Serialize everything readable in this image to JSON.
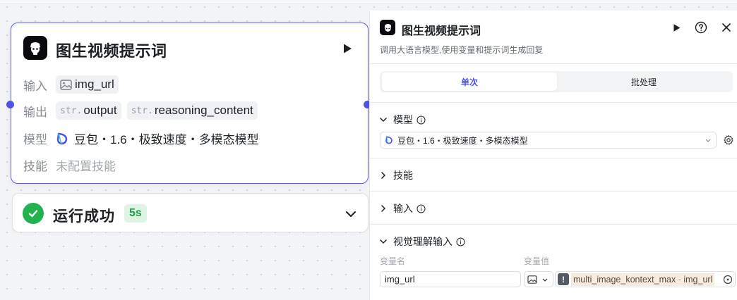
{
  "node": {
    "title": "图生视频提示词",
    "input_label": "输入",
    "input_tags": [
      {
        "text": "img_url"
      }
    ],
    "output_label": "输出",
    "output_tags": [
      {
        "prefix": "str.",
        "text": "output"
      },
      {
        "prefix": "str.",
        "text": "reasoning_content"
      }
    ],
    "model_label": "模型",
    "model_value": "豆包・1.6・极致速度・多模态模型",
    "skill_label": "技能",
    "skill_value": "未配置技能"
  },
  "status": {
    "text": "运行成功",
    "duration": "5s"
  },
  "panel": {
    "title": "图生视频提示词",
    "description": "调用大语言模型,使用变量和提示词生成回复",
    "tabs": [
      {
        "label": "单次",
        "active": true
      },
      {
        "label": "批处理",
        "active": false
      }
    ],
    "model_section": "模型",
    "model_select": "豆包・1.6・极致速度・多模态模型",
    "skills_section": "技能",
    "input_section": "输入",
    "vision_section": "视觉理解输入",
    "var_name_label": "变量名",
    "var_value_label": "变量值",
    "var_name_value": "img_url",
    "ref_node": "multi_image_kontext_max",
    "ref_separator": "-",
    "ref_var": "img_url"
  },
  "colors": {
    "accent": "#4d53e8",
    "success": "#21b34d",
    "node_icon_bg": "#0b0b0f"
  }
}
